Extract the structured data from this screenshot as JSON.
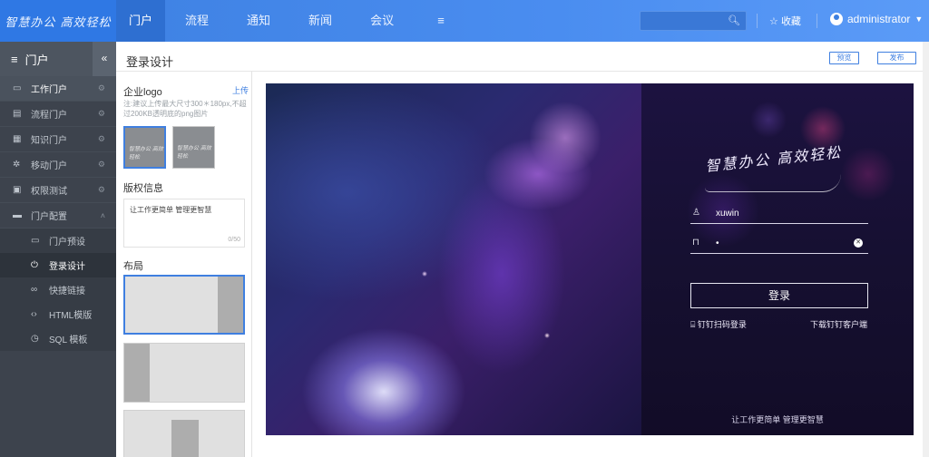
{
  "brand": {
    "logo_text": "智慧办公 高效轻松"
  },
  "nav": {
    "items": [
      "门户",
      "流程",
      "通知",
      "新闻",
      "会议"
    ],
    "more_icon": "menu-icon"
  },
  "header": {
    "search_placeholder": "",
    "favorites_label": "收藏",
    "user_name": "administrator"
  },
  "sidebar": {
    "title": "门户",
    "collapse_symbol": "«",
    "items": [
      {
        "label": "工作门户",
        "icon": "monitor-icon"
      },
      {
        "label": "流程门户",
        "icon": "list-icon"
      },
      {
        "label": "知识门户",
        "icon": "grid-icon"
      },
      {
        "label": "移动门户",
        "icon": "gear-icon"
      },
      {
        "label": "权限测试",
        "icon": "doc-icon"
      },
      {
        "label": "门户配置",
        "icon": "folder-icon"
      }
    ],
    "sub_items": [
      {
        "label": "门户预设",
        "icon": "window-icon"
      },
      {
        "label": "登录设计",
        "icon": "power-icon"
      },
      {
        "label": "快捷链接",
        "icon": "link-icon"
      },
      {
        "label": "HTML模版",
        "icon": "code-icon"
      },
      {
        "label": "SQL 模板",
        "icon": "clock-icon"
      }
    ]
  },
  "page": {
    "title": "登录设计",
    "preview_button": "预览",
    "publish_button": "发布"
  },
  "panel": {
    "logo_section": "企业logo",
    "upload_link": "上传",
    "hint": "注:建议上传最大尺寸300＊180px,不超过200KB透明底的png图片",
    "thumb_text": "智慧办公 高效轻松",
    "copyright_section": "版权信息",
    "copyright_value": "让工作更简单 管理更智慧",
    "copyright_counter": "0/50",
    "layout_section": "布局"
  },
  "login_preview": {
    "logo_text": "智慧办公 高效轻松",
    "username": "xuwin",
    "password": "•",
    "login_button": "登录",
    "scan_login": "钉钉扫码登录",
    "download_client": "下载钉钉客户端",
    "slogan": "让工作更简单 管理更智慧"
  }
}
